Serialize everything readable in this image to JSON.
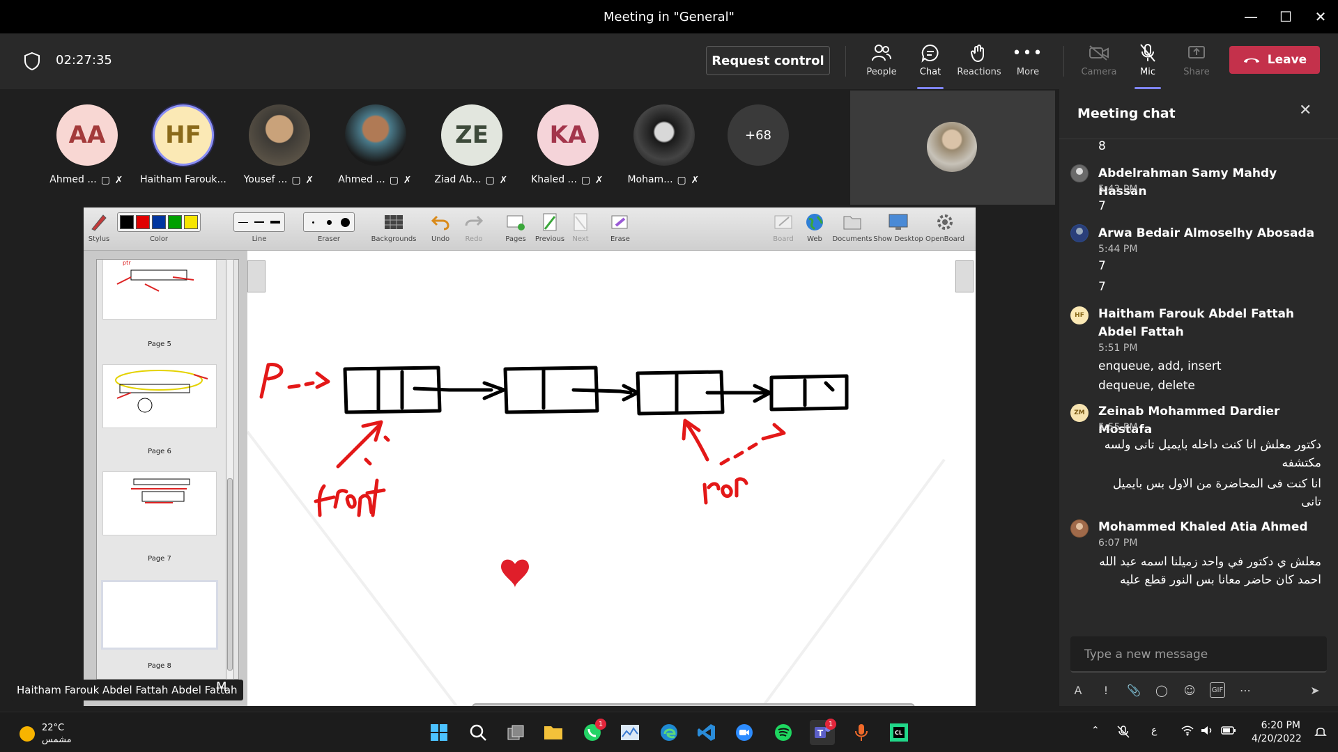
{
  "window": {
    "title": "Meeting in \"General\""
  },
  "meeting": {
    "timer": "02:27:35",
    "request_control": "Request control",
    "tools": {
      "people": "People",
      "chat": "Chat",
      "reactions": "Reactions",
      "more": "More",
      "camera": "Camera",
      "mic": "Mic",
      "share": "Share"
    },
    "leave": "Leave"
  },
  "participants": [
    {
      "initials": "AA",
      "name": "Ahmed ..."
    },
    {
      "initials": "HF",
      "name": "Haitham Farouk..."
    },
    {
      "initials": "",
      "name": "Yousef ..."
    },
    {
      "initials": "",
      "name": "Ahmed ..."
    },
    {
      "initials": "ZE",
      "name": "Ziad Ab..."
    },
    {
      "initials": "KA",
      "name": "Khaled ..."
    },
    {
      "initials": "",
      "name": "Moham..."
    }
  ],
  "more_participants": "+68",
  "openboard": {
    "toolbar": {
      "stylus": "Stylus",
      "color": "Color",
      "line": "Line",
      "eraser": "Eraser",
      "backgrounds": "Backgrounds",
      "undo": "Undo",
      "redo": "Redo",
      "pages": "Pages",
      "previous": "Previous",
      "next": "Next",
      "erase": "Erase",
      "board": "Board",
      "web": "Web",
      "documents": "Documents",
      "show_desktop": "Show Desktop",
      "openboard": "OpenBoard"
    },
    "colors": [
      "#000000",
      "#e00000",
      "#0035a0",
      "#00a000",
      "#f6e500"
    ],
    "pages": [
      "Page 5",
      "Page 6",
      "Page 7",
      "Page 8"
    ],
    "drawing": {
      "label_front": "front",
      "label_rear": "rear",
      "label_p": "P"
    },
    "presenter_tag": "Haitham Farouk Abdel Fattah Abdel Fattah",
    "cut_letter": "M"
  },
  "chat": {
    "title": "Meeting chat",
    "messages": [
      {
        "author": "",
        "time": "",
        "lines": [
          "8"
        ]
      },
      {
        "author": "Abdelrahman Samy Mahdy Hassan",
        "time": "5:43 PM",
        "lines": [
          "7"
        ]
      },
      {
        "author": "Arwa Bedair Almoselhy Abosada",
        "time": "5:44 PM",
        "lines": [
          "7",
          "7"
        ]
      },
      {
        "author": "Haitham Farouk Abdel Fattah Abdel Fattah",
        "time": "5:51 PM",
        "lines": [
          "enqueue, add, insert",
          "dequeue, delete"
        ],
        "initials": "HF"
      },
      {
        "author": "Zeinab Mohammed Dardier Mostafa",
        "time": "5:55 PM",
        "lines": [
          "دكتور معلش انا كنت داخله بايميل تانى ولسه مكتشفه",
          "انا كنت فى المحاضرة من الاول بس بايميل تانى"
        ],
        "initials": "ZM"
      },
      {
        "author": "Mohammed Khaled Atia Ahmed",
        "time": "6:07 PM",
        "lines": [
          "معلش ي دكتور في واحد زميلنا اسمه عبد الله احمد كان حاضر معانا بس النور قطع عليه"
        ]
      }
    ],
    "compose_placeholder": "Type a new message"
  },
  "taskbar": {
    "temp": "22°C",
    "condition": "مشمس",
    "time": "6:20 PM",
    "date": "4/20/2022",
    "lang": "ع",
    "badges": {
      "whatsapp": "1",
      "teams": "1"
    }
  }
}
